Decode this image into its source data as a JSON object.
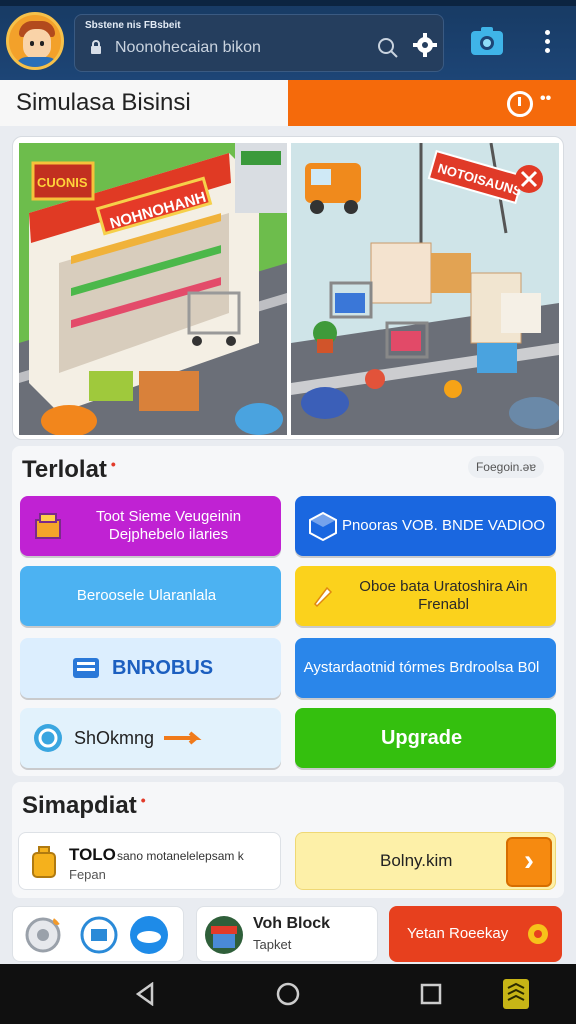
{
  "header": {
    "search_caption": "Sbstene nis FBsbeit",
    "search_placeholder": "Noonohecaian bikon"
  },
  "titlebar": {
    "title": "Simulasa Bisinsi",
    "dots": "••"
  },
  "hero": {
    "left_sign_top": "NOHNOHANH",
    "left_sign_side": "CUONIS",
    "right_sign": "NOTOISAUNS"
  },
  "section1": {
    "title": "Terlolat",
    "link": "Foegoin.ǝɐ",
    "tiles": [
      {
        "label": "Toot Sieme Veugeinin Dejphebelo ilaries"
      },
      {
        "label": "Pnooras VOB. BNDE VADIOO"
      },
      {
        "label": "Beroosele Ularanlala"
      },
      {
        "label": "Oboe bata Uratoshira Ain Frenabl"
      },
      {
        "label": "BNROBUS"
      },
      {
        "label": "Aystardaotnid tórmes Brdroolsa B0l"
      },
      {
        "label": "ShOkmng"
      },
      {
        "label": "Upgrade"
      }
    ]
  },
  "section2": {
    "title": "Simapdiat",
    "toko_name": "TOLO",
    "toko_desc": "sano motanelelepsam k",
    "toko_sub": "Fepan",
    "buy_label": "Bolny.kim",
    "buy_arrow": "›"
  },
  "dock": {
    "mid_name": "Voh Block",
    "mid_sub": "Tapket",
    "right_label": "Yetan Roeekay"
  },
  "colors": {
    "brand_orange": "#f56a0b",
    "header_blue": "#1d4576",
    "upgrade_green": "#34c00e"
  }
}
